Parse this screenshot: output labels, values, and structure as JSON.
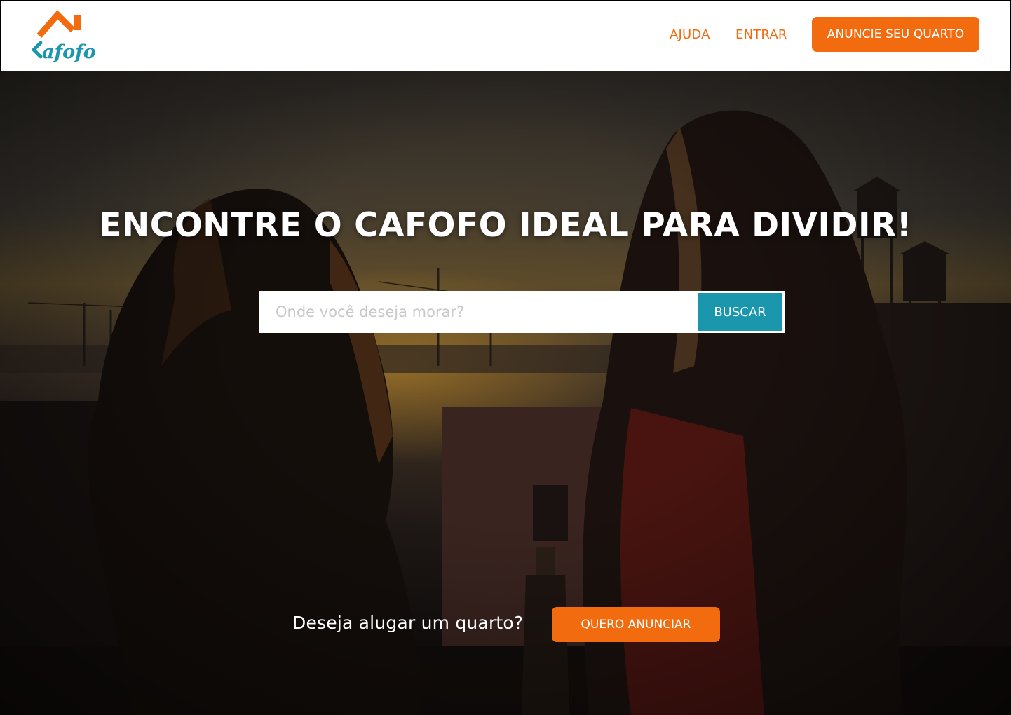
{
  "header": {
    "logo_text": "Cafofo",
    "nav": [
      {
        "label": "AJUDA"
      },
      {
        "label": "ENTRAR"
      }
    ],
    "cta_label": "ANUNCIE SEU QUARTO"
  },
  "hero": {
    "title": "ENCONTRE O CAFOFO IDEAL PARA DIVIDIR!",
    "search": {
      "placeholder": "Onde você deseja morar?",
      "value": "",
      "button_label": "BUSCAR"
    },
    "bottom": {
      "question": "Deseja alugar um quarto?",
      "button_label": "QUERO ANUNCIAR"
    }
  },
  "colors": {
    "brand_orange": "#f26b0f",
    "brand_teal": "#1a97ad",
    "header_bg": "#ffffff"
  },
  "icons": {
    "logo": "house-roof-logo-icon"
  }
}
